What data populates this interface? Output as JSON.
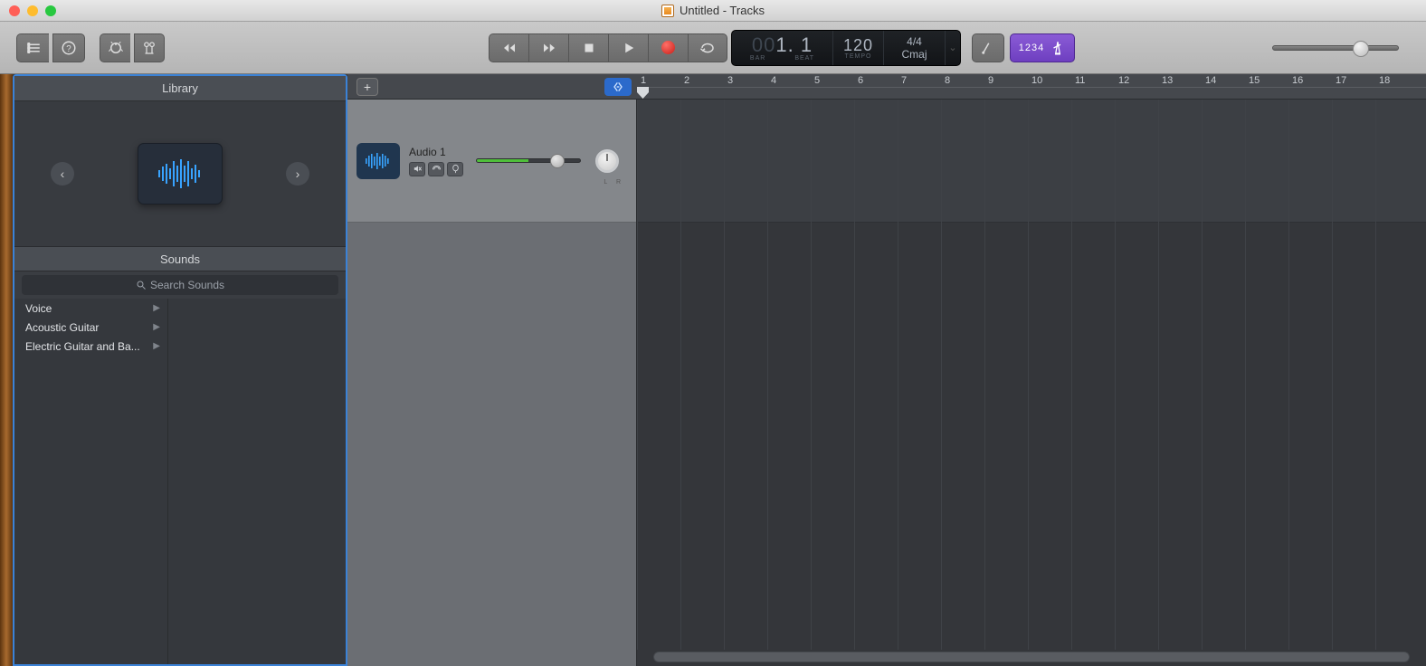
{
  "window": {
    "title": "Untitled - Tracks"
  },
  "toolbar": {
    "lcd": {
      "bar_dim": "00",
      "bar": "1. 1",
      "bar_label": "BAR",
      "beat_label": "BEAT",
      "tempo": "120",
      "tempo_label": "TEMPO",
      "time_sig": "4/4",
      "key": "Cmaj"
    },
    "mode_numbers": "1234"
  },
  "volume": {
    "master_pct": 63
  },
  "library": {
    "title": "Library",
    "sounds_title": "Sounds",
    "search_placeholder": "Search Sounds",
    "categories": [
      {
        "label": "Voice"
      },
      {
        "label": "Acoustic Guitar"
      },
      {
        "label": "Electric Guitar and Ba..."
      }
    ]
  },
  "timeline": {
    "bars": [
      "1",
      "2",
      "3",
      "4",
      "5",
      "6",
      "7",
      "8",
      "9",
      "10",
      "11",
      "12",
      "13",
      "14",
      "15",
      "16",
      "17",
      "18"
    ]
  },
  "tracks": [
    {
      "name": "Audio 1",
      "pan_label": "L   R"
    }
  ]
}
